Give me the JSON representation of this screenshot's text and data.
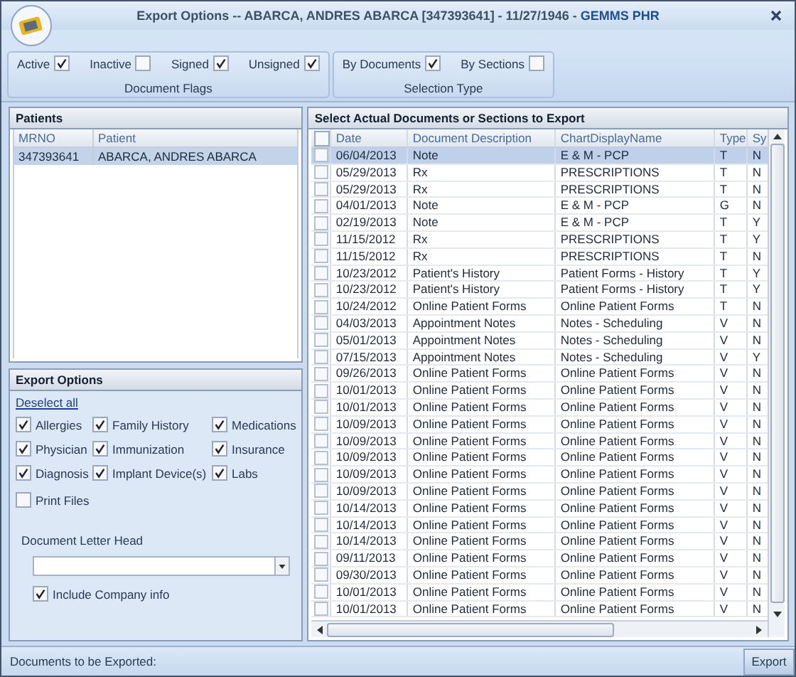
{
  "window": {
    "title": "Export Options -- ABARCA, ANDRES ABARCA [347393641] - 11/27/1946 - ",
    "brand": "GEMMS PHR"
  },
  "ribbon": [
    {
      "label": "Document Flags",
      "items": [
        {
          "label": "Active",
          "checked": true
        },
        {
          "label": "Inactive",
          "checked": false
        },
        {
          "label": "Signed",
          "checked": true
        },
        {
          "label": "Unsigned",
          "checked": true
        }
      ]
    },
    {
      "label": "Selection Type",
      "items": [
        {
          "label": "By Documents",
          "checked": true
        },
        {
          "label": "By Sections",
          "checked": false
        }
      ]
    }
  ],
  "patients": {
    "title": "Patients",
    "columns": [
      "MRNO",
      "Patient"
    ],
    "rows": [
      {
        "selected": true,
        "cells": [
          "347393641",
          "ABARCA, ANDRES ABARCA"
        ]
      }
    ]
  },
  "export_options": {
    "title": "Export Options",
    "deselect_link": "Deselect all",
    "options": [
      {
        "label": "Allergies",
        "checked": true
      },
      {
        "label": "Family History",
        "checked": true
      },
      {
        "label": "Medications",
        "checked": true
      },
      {
        "label": "Physician",
        "checked": true
      },
      {
        "label": "Immunization",
        "checked": true
      },
      {
        "label": "Insurance",
        "checked": true
      },
      {
        "label": "Diagnosis",
        "checked": true
      },
      {
        "label": "Implant Device(s)",
        "checked": true
      },
      {
        "label": "Labs",
        "checked": true
      }
    ],
    "print_files": {
      "label": "Print Files",
      "checked": false
    },
    "letter_head": {
      "label": "Document Letter Head"
    },
    "include_company": {
      "label": "Include Company info",
      "checked": true
    }
  },
  "documents": {
    "title": "Select Actual Documents or Sections to Export",
    "all_checked": false,
    "columns": [
      "Date",
      "Document Description",
      "ChartDisplayName",
      "Type",
      "Sy"
    ],
    "rows": [
      {
        "checked": false,
        "selected": true,
        "cells": [
          "06/04/2013",
          "Note",
          "E & M - PCP",
          "T",
          "N"
        ]
      },
      {
        "checked": false,
        "selected": false,
        "cells": [
          "05/29/2013",
          "Rx",
          "PRESCRIPTIONS",
          "T",
          "N"
        ]
      },
      {
        "checked": false,
        "selected": false,
        "cells": [
          "05/29/2013",
          "Rx",
          "PRESCRIPTIONS",
          "T",
          "N"
        ]
      },
      {
        "checked": false,
        "selected": false,
        "cells": [
          "04/01/2013",
          "Note",
          "E & M - PCP",
          "G",
          "N"
        ]
      },
      {
        "checked": false,
        "selected": false,
        "cells": [
          "02/19/2013",
          "Note",
          "E & M - PCP",
          "T",
          "Y"
        ]
      },
      {
        "checked": false,
        "selected": false,
        "cells": [
          "11/15/2012",
          "Rx",
          "PRESCRIPTIONS",
          "T",
          "Y"
        ]
      },
      {
        "checked": false,
        "selected": false,
        "cells": [
          "11/15/2012",
          "Rx",
          "PRESCRIPTIONS",
          "T",
          "N"
        ]
      },
      {
        "checked": false,
        "selected": false,
        "cells": [
          "10/23/2012",
          "Patient's History",
          "Patient Forms - History",
          "T",
          "Y"
        ]
      },
      {
        "checked": false,
        "selected": false,
        "cells": [
          "10/23/2012",
          "Patient's History",
          "Patient Forms - History",
          "T",
          "Y"
        ]
      },
      {
        "checked": false,
        "selected": false,
        "cells": [
          "10/24/2012",
          "Online Patient Forms",
          "Online Patient Forms",
          "T",
          "N"
        ]
      },
      {
        "checked": false,
        "selected": false,
        "cells": [
          "04/03/2013",
          "Appointment Notes",
          "Notes - Scheduling",
          "V",
          "N"
        ]
      },
      {
        "checked": false,
        "selected": false,
        "cells": [
          "05/01/2013",
          "Appointment Notes",
          "Notes - Scheduling",
          "V",
          "N"
        ]
      },
      {
        "checked": false,
        "selected": false,
        "cells": [
          "07/15/2013",
          "Appointment Notes",
          "Notes - Scheduling",
          "V",
          "Y"
        ]
      },
      {
        "checked": false,
        "selected": false,
        "cells": [
          "09/26/2013",
          "Online Patient Forms",
          "Online Patient Forms",
          "V",
          "N"
        ]
      },
      {
        "checked": false,
        "selected": false,
        "cells": [
          "10/01/2013",
          "Online Patient Forms",
          "Online Patient Forms",
          "V",
          "N"
        ]
      },
      {
        "checked": false,
        "selected": false,
        "cells": [
          "10/01/2013",
          "Online Patient Forms",
          "Online Patient Forms",
          "V",
          "N"
        ]
      },
      {
        "checked": false,
        "selected": false,
        "cells": [
          "10/09/2013",
          "Online Patient Forms",
          "Online Patient Forms",
          "V",
          "N"
        ]
      },
      {
        "checked": false,
        "selected": false,
        "cells": [
          "10/09/2013",
          "Online Patient Forms",
          "Online Patient Forms",
          "V",
          "N"
        ]
      },
      {
        "checked": false,
        "selected": false,
        "cells": [
          "10/09/2013",
          "Online Patient Forms",
          "Online Patient Forms",
          "V",
          "N"
        ]
      },
      {
        "checked": false,
        "selected": false,
        "cells": [
          "10/09/2013",
          "Online Patient Forms",
          "Online Patient Forms",
          "V",
          "N"
        ]
      },
      {
        "checked": false,
        "selected": false,
        "cells": [
          "10/09/2013",
          "Online Patient Forms",
          "Online Patient Forms",
          "V",
          "N"
        ]
      },
      {
        "checked": false,
        "selected": false,
        "cells": [
          "10/14/2013",
          "Online Patient Forms",
          "Online Patient Forms",
          "V",
          "N"
        ]
      },
      {
        "checked": false,
        "selected": false,
        "cells": [
          "10/14/2013",
          "Online Patient Forms",
          "Online Patient Forms",
          "V",
          "N"
        ]
      },
      {
        "checked": false,
        "selected": false,
        "cells": [
          "10/14/2013",
          "Online Patient Forms",
          "Online Patient Forms",
          "V",
          "N"
        ]
      },
      {
        "checked": false,
        "selected": false,
        "cells": [
          "09/11/2013",
          "Online Patient Forms",
          "Online Patient Forms",
          "V",
          "N"
        ]
      },
      {
        "checked": false,
        "selected": false,
        "cells": [
          "09/30/2013",
          "Online Patient Forms",
          "Online Patient Forms",
          "V",
          "N"
        ]
      },
      {
        "checked": false,
        "selected": false,
        "cells": [
          "10/01/2013",
          "Online Patient Forms",
          "Online Patient Forms",
          "V",
          "N"
        ]
      },
      {
        "checked": false,
        "selected": false,
        "cells": [
          "10/01/2013",
          "Online Patient Forms",
          "Online Patient Forms",
          "V",
          "N"
        ]
      }
    ]
  },
  "status_bar": {
    "text": "Documents to be Exported:"
  },
  "export_button": "Export"
}
